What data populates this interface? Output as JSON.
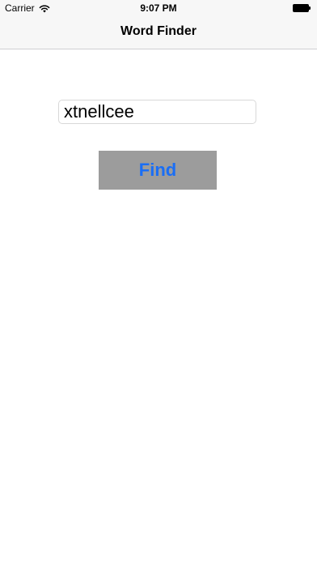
{
  "status_bar": {
    "carrier": "Carrier",
    "time": "9:07 PM",
    "wifi_icon": "wifi-icon",
    "battery_icon": "battery-icon"
  },
  "nav": {
    "title": "Word Finder"
  },
  "form": {
    "input_value": "xtnellcee",
    "find_label": "Find"
  },
  "colors": {
    "bar_background": "#f7f7f7",
    "button_background": "#9c9c9c",
    "button_text": "#1a6ef5"
  }
}
